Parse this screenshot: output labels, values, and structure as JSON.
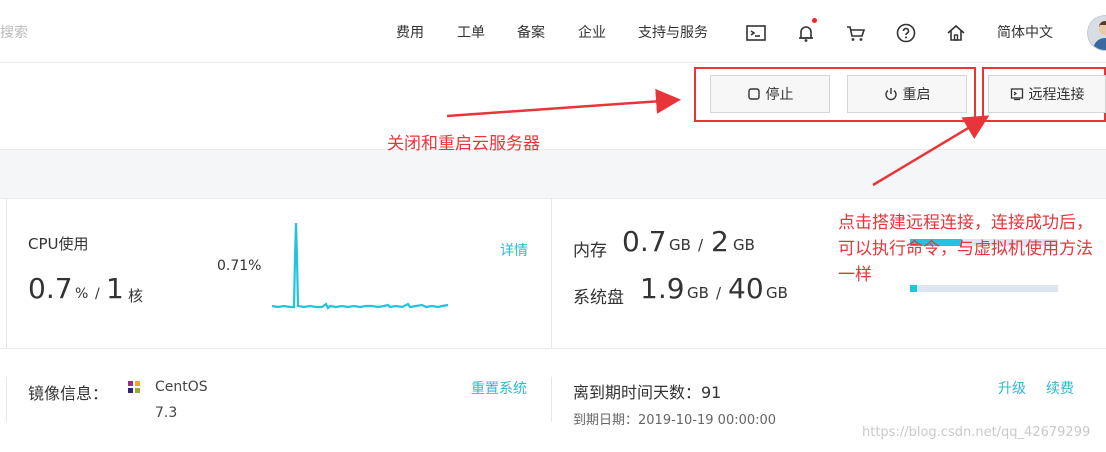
{
  "header": {
    "search_placeholder": "搜索",
    "nav": [
      "费用",
      "工单",
      "备案",
      "企业",
      "支持与服务"
    ],
    "icons": [
      "terminal-icon",
      "bell-icon",
      "cart-icon",
      "help-icon",
      "home-icon"
    ],
    "language": "简体中文"
  },
  "toolbar": {
    "stop_label": "停止",
    "restart_label": "重启",
    "remote_label": "远程连接"
  },
  "annotations": {
    "stop_restart_note": "关闭和重启云服务器",
    "remote_note": "点击搭建远程连接，连接成功后，可以执行命令，与虚拟机使用方法一样"
  },
  "cpu": {
    "title": "CPU使用",
    "details_label": "详情",
    "value": "0.7",
    "unit": "%",
    "separator": "/",
    "cores": "1",
    "cores_unit": "核",
    "peak_label": "0.71%"
  },
  "memory": {
    "label": "内存",
    "used": "0.7",
    "used_unit": "GB",
    "separator": "/",
    "total": "2",
    "total_unit": "GB"
  },
  "disk": {
    "label": "系统盘",
    "used": "1.9",
    "used_unit": "GB",
    "separator": "/",
    "total": "40",
    "total_unit": "GB"
  },
  "image_info": {
    "label": "镜像信息：",
    "os_name": "CentOS",
    "os_version": "7.3",
    "reset_label": "重置系统"
  },
  "expiry": {
    "days_label": "离到期时间天数：91",
    "date_label": "到期日期：2019-10-19 00:00:00",
    "upgrade_label": "升级",
    "renew_label": "续费"
  },
  "watermark": "https://blog.csdn.net/qq_42679299",
  "colors": {
    "accent": "#2fb8d0",
    "annotation_red": "#e8353a",
    "sparkline": "#22c3dc"
  }
}
